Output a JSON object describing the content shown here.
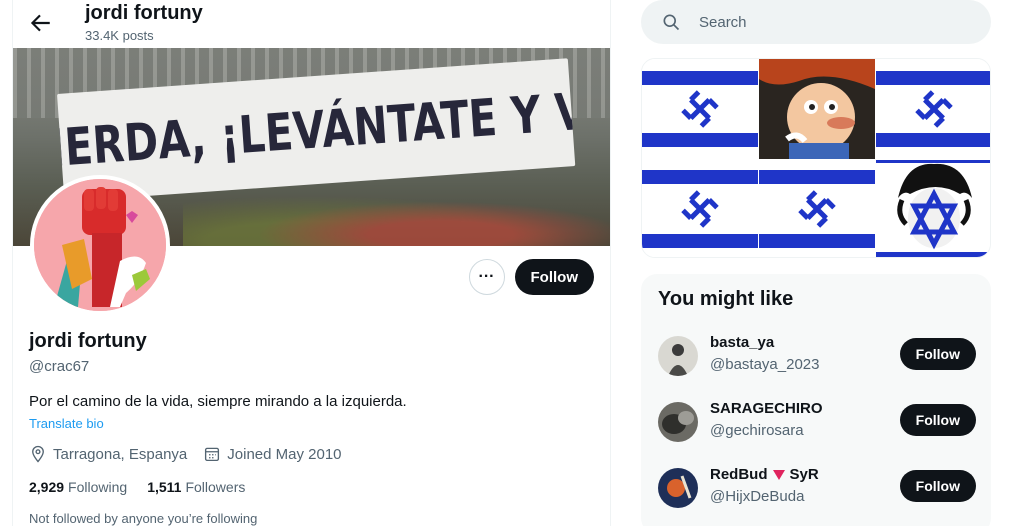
{
  "header": {
    "name": "jordi fortuny",
    "posts_count": "33.4K posts"
  },
  "banner": {
    "text": "IZQUIERDA, ¡LEVÁNTATE Y VOTA!"
  },
  "profile": {
    "display_name": "jordi fortuny",
    "handle": "@crac67",
    "bio": "Por el camino de la vida, siempre mirando a la izquierda.",
    "translate_label": "Translate bio",
    "location": "Tarragona, Espanya",
    "joined": "Joined May 2010",
    "following_count": "2,929",
    "following_label": "Following",
    "followers_count": "1,511",
    "followers_label": "Followers",
    "followed_by_note": "Not followed by anyone you’re following",
    "follow_label": "Follow",
    "more_label": "···"
  },
  "search": {
    "placeholder": "Search"
  },
  "who_to_follow": {
    "title": "You might like",
    "users": [
      {
        "name": "basta_ya",
        "handle": "@bastaya_2023",
        "follow_label": "Follow"
      },
      {
        "name": "SARAGECHIRO",
        "handle": "@gechirosara",
        "follow_label": "Follow"
      },
      {
        "name": "RedBud",
        "name_suffix": "SyR",
        "handle": "@HijxDeBuda",
        "follow_label": "Follow"
      }
    ]
  },
  "colors": {
    "accent": "#1d9bf0",
    "follow_button": "#0f1419",
    "flag_blue": "#1f35c8"
  },
  "icons": [
    "back-arrow-icon",
    "search-icon",
    "location-icon",
    "calendar-icon",
    "triangle-down-icon"
  ]
}
